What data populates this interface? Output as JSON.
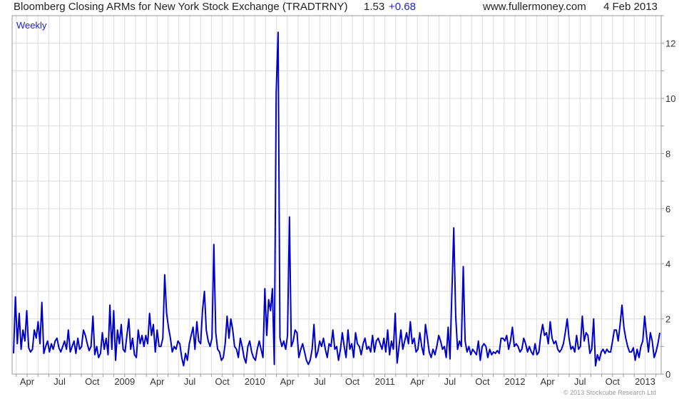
{
  "header": {
    "title": "Bloomberg Closing ARMs for New York Stock Exchange (TRADTRNY)",
    "last": "1.53",
    "change": "+0.68",
    "site": "www.fullermoney.com",
    "date": "4 Feb 2013"
  },
  "copyright": "© 2013 Stockcube Research Ltd",
  "colors": {
    "line": "#0000cc",
    "grid": "#dcdcdc",
    "frame": "#999999",
    "change": "#2222cc"
  },
  "chart_data": {
    "type": "line",
    "frequency_label": "Weekly",
    "ylim": [
      0,
      13
    ],
    "y_ticks": [
      "0",
      "2",
      "4",
      "6",
      "8",
      "10",
      "12"
    ],
    "x_ticks": [
      "Apr",
      "Jul",
      "Oct",
      "2009",
      "Apr",
      "Jul",
      "Oct",
      "2010",
      "Apr",
      "Jul",
      "Oct",
      "2011",
      "Apr",
      "Jul",
      "Oct",
      "2012",
      "Apr",
      "Jul",
      "Oct",
      "2013"
    ],
    "series": [
      {
        "values": [
          0.75,
          2.8,
          1.1,
          2.2,
          0.9,
          1.6,
          1.2,
          2.3,
          0.95,
          0.8,
          0.9,
          1.6,
          1.3,
          1.9,
          1.1,
          2.6,
          0.75,
          1.0,
          1.2,
          0.8,
          1.1,
          0.9,
          1.2,
          1.3,
          0.95,
          0.8,
          1.0,
          1.2,
          0.9,
          1.6,
          0.8,
          1.0,
          1.2,
          0.75,
          1.3,
          0.9,
          1.0,
          1.6,
          1.4,
          1.1,
          0.85,
          1.0,
          2.1,
          0.7,
          1.0,
          0.6,
          0.75,
          1.5,
          0.9,
          1.3,
          0.7,
          2.5,
          0.9,
          2.3,
          0.5,
          1.6,
          1.1,
          1.8,
          0.9,
          0.8,
          1.4,
          2.0,
          0.9,
          1.3,
          0.7,
          0.6,
          1.6,
          1.1,
          1.4,
          1.0,
          1.4,
          1.1,
          2.2,
          1.4,
          1.8,
          0.8,
          1.6,
          1.0,
          1.0,
          1.3,
          3.6,
          2.2,
          1.7,
          1.3,
          0.8,
          1.0,
          0.9,
          1.2,
          1.1,
          0.6,
          0.3,
          0.75,
          0.5,
          1.1,
          1.4,
          1.7,
          0.9,
          1.9,
          1.2,
          1.1,
          2.3,
          3.0,
          1.6,
          1.2,
          1.0,
          1.3,
          4.7,
          1.5,
          0.9,
          0.8,
          0.5,
          0.6,
          1.1,
          2.1,
          1.3,
          2.0,
          1.6,
          1.0,
          0.9,
          0.6,
          1.3,
          1.0,
          0.6,
          0.4,
          1.0,
          1.2,
          0.8,
          0.6,
          0.5,
          0.9,
          1.2,
          0.9,
          0.6,
          3.1,
          1.4,
          2.7,
          2.3,
          3.1,
          0.35,
          10.2,
          12.4,
          1.3,
          1.0,
          1.2,
          0.9,
          1.4,
          5.7,
          1.0,
          1.2,
          1.6,
          1.5,
          0.6,
          0.9,
          1.1,
          0.8,
          0.5,
          0.35,
          0.5,
          0.9,
          1.8,
          0.6,
          0.8,
          1.2,
          1.0,
          1.3,
          0.9,
          0.6,
          1.1,
          1.0,
          1.6,
          0.9,
          1.0,
          0.5,
          0.9,
          1.5,
          1.0,
          0.6,
          1.6,
          0.9,
          1.1,
          0.6,
          1.5,
          1.1,
          1.0,
          0.7,
          1.1,
          1.3,
          0.9,
          1.0,
          0.8,
          1.4,
          0.8,
          1.2,
          1.3,
          1.1,
          0.9,
          1.3,
          0.8,
          1.6,
          0.7,
          1.2,
          0.9,
          2.2,
          0.4,
          1.0,
          1.6,
          0.9,
          1.2,
          1.5,
          1.1,
          1.9,
          1.1,
          1.3,
          0.8,
          0.9,
          1.5,
          1.0,
          0.7,
          1.8,
          1.3,
          0.8,
          0.6,
          0.9,
          0.7,
          1.0,
          1.4,
          1.2,
          0.9,
          1.0,
          0.6,
          1.7,
          0.55,
          3.0,
          5.3,
          2.1,
          0.9,
          1.2,
          1.0,
          3.9,
          1.2,
          0.8,
          1.0,
          0.7,
          0.9,
          0.8,
          0.7,
          1.2,
          0.5,
          1.0,
          1.1,
          1.0,
          0.6,
          0.9,
          0.7,
          0.8,
          0.75,
          0.85,
          0.75,
          1.3,
          1.3,
          1.2,
          1.4,
          0.9,
          1.2,
          1.7,
          1.0,
          1.1,
          1.0,
          0.8,
          0.9,
          1.3,
          1.1,
          0.8,
          1.0,
          0.8,
          0.7,
          1.1,
          0.7,
          0.8,
          1.4,
          1.8,
          1.4,
          1.5,
          1.1,
          1.9,
          1.3,
          1.1,
          1.2,
          0.9,
          0.8,
          0.9,
          1.1,
          1.5,
          2.0,
          1.3,
          0.9,
          1.0,
          0.8,
          1.4,
          0.9,
          1.0,
          2.1,
          1.2,
          1.5,
          1.4,
          0.75,
          0.9,
          2.0,
          0.3,
          0.7,
          0.5,
          0.8,
          0.9,
          0.75,
          0.9,
          0.8,
          0.8,
          1.2,
          1.6,
          1.6,
          1.2,
          1.8,
          2.5,
          1.7,
          1.3,
          1.0,
          0.8,
          0.8,
          0.95,
          0.5,
          0.9,
          0.6,
          1.0,
          1.2,
          2.1,
          1.4,
          0.8,
          1.5,
          1.2,
          0.6,
          0.8,
          1.1,
          1.5
        ]
      }
    ]
  }
}
